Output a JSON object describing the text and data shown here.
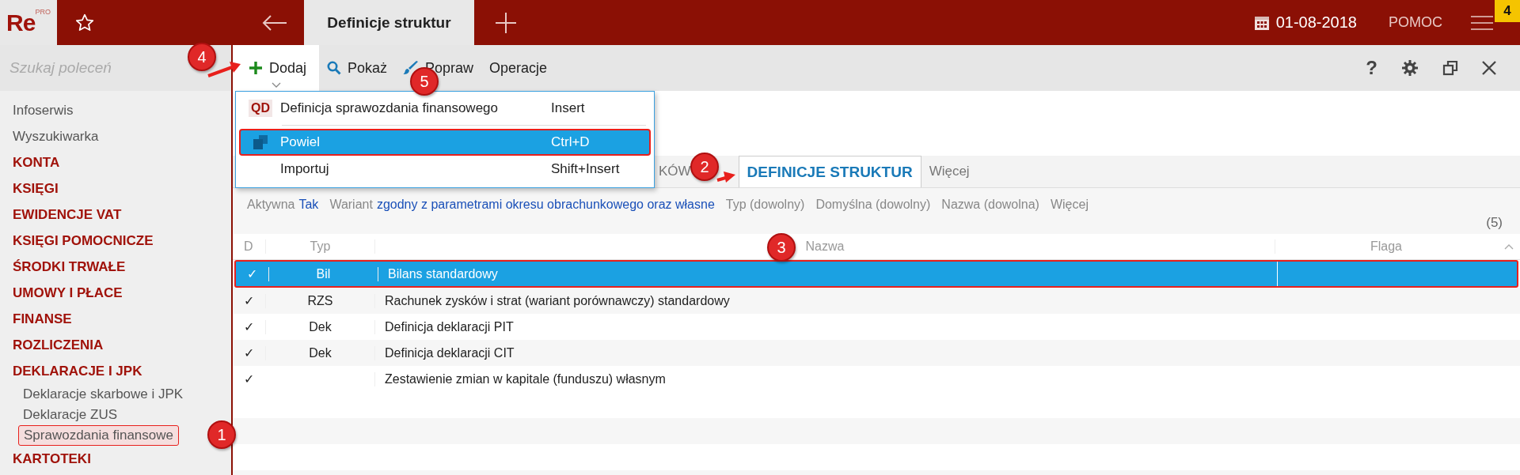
{
  "app": {
    "logo": "Re",
    "logo_sup": "PRO",
    "date": "01-08-2018",
    "help": "POMOC",
    "badge": "4"
  },
  "tabs": [
    {
      "label": "Definicje struktur",
      "selected": true
    }
  ],
  "sidebar": {
    "search_placeholder": "Szukaj poleceń",
    "items": [
      {
        "label": "Infoserwis",
        "kind": "link"
      },
      {
        "label": "Wyszukiwarka",
        "kind": "link"
      },
      {
        "label": "KONTA",
        "kind": "section"
      },
      {
        "label": "KSIĘGI",
        "kind": "section"
      },
      {
        "label": "EWIDENCJE VAT",
        "kind": "section"
      },
      {
        "label": "KSIĘGI POMOCNICZE",
        "kind": "section"
      },
      {
        "label": "ŚRODKI TRWAŁE",
        "kind": "section"
      },
      {
        "label": "UMOWY I PŁACE",
        "kind": "section"
      },
      {
        "label": "FINANSE",
        "kind": "section"
      },
      {
        "label": "ROZLICZENIA",
        "kind": "section"
      },
      {
        "label": "DEKLARACJE I JPK",
        "kind": "section",
        "children": [
          {
            "label": "Deklaracje skarbowe i JPK",
            "selected": false
          },
          {
            "label": "Deklaracje ZUS",
            "selected": false
          },
          {
            "label": "Sprawozdania finansowe",
            "selected": true
          }
        ]
      },
      {
        "label": "KARTOTEKI",
        "kind": "section"
      }
    ]
  },
  "toolbar": {
    "buttons": [
      {
        "label": "Dodaj",
        "kind": "plus",
        "expanded": true
      },
      {
        "label": "Pokaż",
        "kind": "search",
        "expanded": false
      },
      {
        "label": "Popraw",
        "kind": "brush",
        "expanded": false
      },
      {
        "label": "Operacje",
        "kind": "text",
        "expanded": false
      }
    ]
  },
  "menu": {
    "items": [
      {
        "label": "Definicja sprawozdania finansowego",
        "shortcut": "Insert",
        "kind": "badge",
        "badge": "QD",
        "selected": false
      },
      {
        "label": "Powiel",
        "shortcut": "Ctrl+D",
        "kind": "copy",
        "selected": true
      },
      {
        "label": "Importuj",
        "shortcut": "Shift+Insert",
        "kind": "plain",
        "selected": false
      }
    ],
    "help_label": "?"
  },
  "view_tabs": [
    {
      "label": "KÓW",
      "selected": false
    },
    {
      "label": "DEFINICJE STRUKTUR",
      "selected": true
    },
    {
      "label": "Więcej",
      "selected": false
    }
  ],
  "filters": [
    {
      "label": "Aktywna",
      "value": "Tak"
    },
    {
      "label": "Wariant",
      "value": "zgodny z parametrami okresu obrachunkowego oraz własne"
    },
    {
      "label": "Typ (dowolny)"
    },
    {
      "label": "Domyślna (dowolny)"
    },
    {
      "label": "Nazwa (dowolna)"
    },
    {
      "label": "Więcej"
    }
  ],
  "count": "(5)",
  "table": {
    "columns": [
      "D",
      "Typ",
      "Nazwa",
      "Flaga"
    ],
    "rows": [
      {
        "d": "✓",
        "typ": "Bil",
        "nazwa": "Bilans standardowy",
        "selected": true
      },
      {
        "d": "✓",
        "typ": "RZS",
        "nazwa": "Rachunek zysków i strat (wariant porównawczy) standardowy",
        "selected": false
      },
      {
        "d": "✓",
        "typ": "Dek",
        "nazwa": "Definicja deklaracji PIT",
        "selected": false
      },
      {
        "d": "✓",
        "typ": "Dek",
        "nazwa": "Definicja deklaracji CIT",
        "selected": false
      },
      {
        "d": "✓",
        "nazwa": "Zestawienie zmian w kapitale (funduszu) własnym",
        "selected": false
      }
    ]
  },
  "annotations": [
    {
      "label": "1"
    },
    {
      "label": "2"
    },
    {
      "label": "3"
    },
    {
      "label": "4"
    },
    {
      "label": "5"
    }
  ]
}
